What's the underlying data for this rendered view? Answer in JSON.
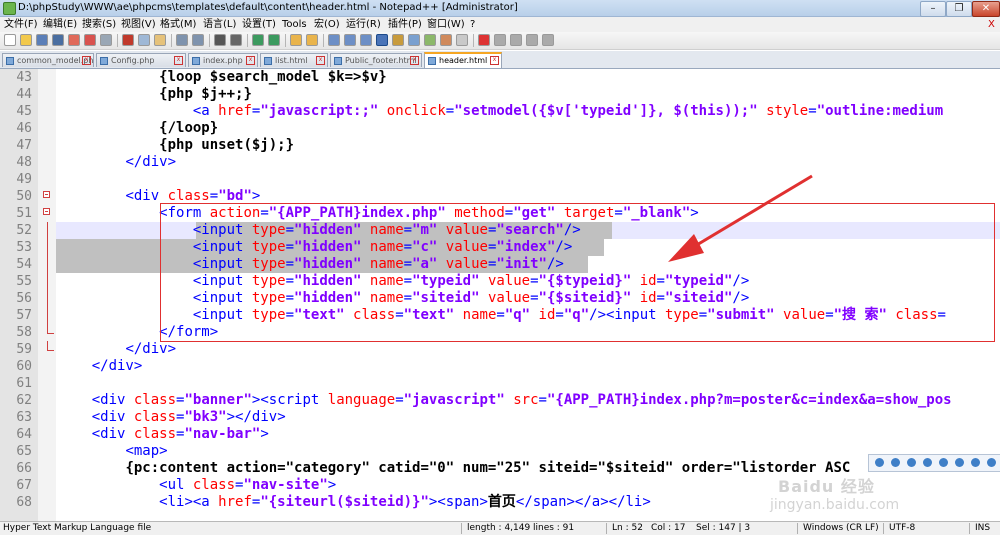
{
  "window": {
    "title": "D:\\phpStudy\\WWW\\ae\\phpcms\\templates\\default\\content\\header.html - Notepad++ [Administrator]",
    "minimize": "–",
    "maximize": "❐",
    "close": "✕"
  },
  "menu": [
    "文件(F)",
    "编辑(E)",
    "搜索(S)",
    "视图(V)",
    "格式(M)",
    "语言(L)",
    "设置(T)",
    "Tools",
    "宏(O)",
    "运行(R)",
    "插件(P)",
    "窗口(W)",
    "?"
  ],
  "menu_close": "X",
  "tabs": [
    {
      "label": "common_model.php",
      "active": false
    },
    {
      "label": "Config.php",
      "active": false
    },
    {
      "label": "index.php",
      "active": false
    },
    {
      "label": "list.html",
      "active": false
    },
    {
      "label": "Public_footer.html",
      "active": false
    },
    {
      "label": "header.html",
      "active": true
    }
  ],
  "editor": {
    "lines": [
      {
        "n": "43",
        "tokens": [
          [
            "t-text",
            "            "
          ],
          [
            "t-php",
            "{loop $search_model $k=>$v}"
          ]
        ]
      },
      {
        "n": "44",
        "tokens": [
          [
            "t-text",
            "            "
          ],
          [
            "t-php",
            "{php $j++;}"
          ]
        ]
      },
      {
        "n": "45",
        "tokens": [
          [
            "t-text",
            "                "
          ],
          [
            "t-tag",
            "<a "
          ],
          [
            "t-attr",
            "href"
          ],
          [
            "t-tag",
            "="
          ],
          [
            "t-val",
            "\"javascript:;\""
          ],
          [
            "t-text",
            " "
          ],
          [
            "t-attr",
            "onclick"
          ],
          [
            "t-tag",
            "="
          ],
          [
            "t-val",
            "\"setmodel({$v['typeid']}, $(this));\""
          ],
          [
            "t-text",
            " "
          ],
          [
            "t-attr",
            "style"
          ],
          [
            "t-tag",
            "="
          ],
          [
            "t-val",
            "\"outline:medium"
          ]
        ]
      },
      {
        "n": "46",
        "tokens": [
          [
            "t-text",
            "            "
          ],
          [
            "t-php",
            "{/loop}"
          ]
        ]
      },
      {
        "n": "47",
        "tokens": [
          [
            "t-text",
            "            "
          ],
          [
            "t-php",
            "{php unset($j);}"
          ]
        ]
      },
      {
        "n": "48",
        "tokens": [
          [
            "t-text",
            "        "
          ],
          [
            "t-tag",
            "</div>"
          ]
        ]
      },
      {
        "n": "49",
        "tokens": []
      },
      {
        "n": "50",
        "tokens": [
          [
            "t-text",
            "        "
          ],
          [
            "t-tag",
            "<div "
          ],
          [
            "t-attr",
            "class"
          ],
          [
            "t-tag",
            "="
          ],
          [
            "t-val",
            "\"bd\""
          ],
          [
            "t-tag",
            ">"
          ]
        ]
      },
      {
        "n": "51",
        "tokens": [
          [
            "t-text",
            "            "
          ],
          [
            "t-tag",
            "<form "
          ],
          [
            "t-attr",
            "action"
          ],
          [
            "t-tag",
            "="
          ],
          [
            "t-val",
            "\"{APP_PATH}index.php\""
          ],
          [
            "t-text",
            " "
          ],
          [
            "t-attr",
            "method"
          ],
          [
            "t-tag",
            "="
          ],
          [
            "t-val",
            "\"get\""
          ],
          [
            "t-text",
            " "
          ],
          [
            "t-attr",
            "target"
          ],
          [
            "t-tag",
            "="
          ],
          [
            "t-val",
            "\"_blank\""
          ],
          [
            "t-tag",
            ">"
          ]
        ]
      },
      {
        "n": "52",
        "tokens": [
          [
            "t-text",
            "                "
          ],
          [
            "t-tag",
            "<input "
          ],
          [
            "t-attr",
            "type"
          ],
          [
            "t-tag",
            "="
          ],
          [
            "t-val",
            "\"hidden\""
          ],
          [
            "t-text",
            " "
          ],
          [
            "t-attr",
            "name"
          ],
          [
            "t-tag",
            "="
          ],
          [
            "t-val",
            "\"m\""
          ],
          [
            "t-text",
            " "
          ],
          [
            "t-attr",
            "value"
          ],
          [
            "t-tag",
            "="
          ],
          [
            "t-val",
            "\"search\""
          ],
          [
            "t-tag",
            "/>"
          ]
        ]
      },
      {
        "n": "53",
        "tokens": [
          [
            "t-text",
            "                "
          ],
          [
            "t-tag",
            "<input "
          ],
          [
            "t-attr",
            "type"
          ],
          [
            "t-tag",
            "="
          ],
          [
            "t-val",
            "\"hidden\""
          ],
          [
            "t-text",
            " "
          ],
          [
            "t-attr",
            "name"
          ],
          [
            "t-tag",
            "="
          ],
          [
            "t-val",
            "\"c\""
          ],
          [
            "t-text",
            " "
          ],
          [
            "t-attr",
            "value"
          ],
          [
            "t-tag",
            "="
          ],
          [
            "t-val",
            "\"index\""
          ],
          [
            "t-tag",
            "/>"
          ]
        ]
      },
      {
        "n": "54",
        "tokens": [
          [
            "t-text",
            "                "
          ],
          [
            "t-tag",
            "<input "
          ],
          [
            "t-attr",
            "type"
          ],
          [
            "t-tag",
            "="
          ],
          [
            "t-val",
            "\"hidden\""
          ],
          [
            "t-text",
            " "
          ],
          [
            "t-attr",
            "name"
          ],
          [
            "t-tag",
            "="
          ],
          [
            "t-val",
            "\"a\""
          ],
          [
            "t-text",
            " "
          ],
          [
            "t-attr",
            "value"
          ],
          [
            "t-tag",
            "="
          ],
          [
            "t-val",
            "\"init\""
          ],
          [
            "t-tag",
            "/>"
          ]
        ]
      },
      {
        "n": "55",
        "tokens": [
          [
            "t-text",
            "                "
          ],
          [
            "t-tag",
            "<input "
          ],
          [
            "t-attr",
            "type"
          ],
          [
            "t-tag",
            "="
          ],
          [
            "t-val",
            "\"hidden\""
          ],
          [
            "t-text",
            " "
          ],
          [
            "t-attr",
            "name"
          ],
          [
            "t-tag",
            "="
          ],
          [
            "t-val",
            "\"typeid\""
          ],
          [
            "t-text",
            " "
          ],
          [
            "t-attr",
            "value"
          ],
          [
            "t-tag",
            "="
          ],
          [
            "t-val",
            "\"{$typeid}\""
          ],
          [
            "t-text",
            " "
          ],
          [
            "t-attr",
            "id"
          ],
          [
            "t-tag",
            "="
          ],
          [
            "t-val",
            "\"typeid\""
          ],
          [
            "t-tag",
            "/>"
          ]
        ]
      },
      {
        "n": "56",
        "tokens": [
          [
            "t-text",
            "                "
          ],
          [
            "t-tag",
            "<input "
          ],
          [
            "t-attr",
            "type"
          ],
          [
            "t-tag",
            "="
          ],
          [
            "t-val",
            "\"hidden\""
          ],
          [
            "t-text",
            " "
          ],
          [
            "t-attr",
            "name"
          ],
          [
            "t-tag",
            "="
          ],
          [
            "t-val",
            "\"siteid\""
          ],
          [
            "t-text",
            " "
          ],
          [
            "t-attr",
            "value"
          ],
          [
            "t-tag",
            "="
          ],
          [
            "t-val",
            "\"{$siteid}\""
          ],
          [
            "t-text",
            " "
          ],
          [
            "t-attr",
            "id"
          ],
          [
            "t-tag",
            "="
          ],
          [
            "t-val",
            "\"siteid\""
          ],
          [
            "t-tag",
            "/>"
          ]
        ]
      },
      {
        "n": "57",
        "tokens": [
          [
            "t-text",
            "                "
          ],
          [
            "t-tag",
            "<input "
          ],
          [
            "t-attr",
            "type"
          ],
          [
            "t-tag",
            "="
          ],
          [
            "t-val",
            "\"text\""
          ],
          [
            "t-text",
            " "
          ],
          [
            "t-attr",
            "class"
          ],
          [
            "t-tag",
            "="
          ],
          [
            "t-val",
            "\"text\""
          ],
          [
            "t-text",
            " "
          ],
          [
            "t-attr",
            "name"
          ],
          [
            "t-tag",
            "="
          ],
          [
            "t-val",
            "\"q\""
          ],
          [
            "t-text",
            " "
          ],
          [
            "t-attr",
            "id"
          ],
          [
            "t-tag",
            "="
          ],
          [
            "t-val",
            "\"q\""
          ],
          [
            "t-tag",
            "/><input "
          ],
          [
            "t-attr",
            "type"
          ],
          [
            "t-tag",
            "="
          ],
          [
            "t-val",
            "\"submit\""
          ],
          [
            "t-text",
            " "
          ],
          [
            "t-attr",
            "value"
          ],
          [
            "t-tag",
            "="
          ],
          [
            "t-val",
            "\"搜 索\""
          ],
          [
            "t-text",
            " "
          ],
          [
            "t-attr",
            "class"
          ],
          [
            "t-tag",
            "="
          ]
        ]
      },
      {
        "n": "58",
        "tokens": [
          [
            "t-text",
            "            "
          ],
          [
            "t-tag",
            "</form>"
          ]
        ]
      },
      {
        "n": "59",
        "tokens": [
          [
            "t-text",
            "        "
          ],
          [
            "t-tag",
            "</div>"
          ]
        ]
      },
      {
        "n": "60",
        "tokens": [
          [
            "t-text",
            "    "
          ],
          [
            "t-tag",
            "</div>"
          ]
        ]
      },
      {
        "n": "61",
        "tokens": []
      },
      {
        "n": "62",
        "tokens": [
          [
            "t-text",
            "    "
          ],
          [
            "t-tag",
            "<div "
          ],
          [
            "t-attr",
            "class"
          ],
          [
            "t-tag",
            "="
          ],
          [
            "t-val",
            "\"banner\""
          ],
          [
            "t-tag",
            "><script "
          ],
          [
            "t-attr",
            "language"
          ],
          [
            "t-tag",
            "="
          ],
          [
            "t-val",
            "\"javascript\""
          ],
          [
            "t-text",
            " "
          ],
          [
            "t-attr",
            "src"
          ],
          [
            "t-tag",
            "="
          ],
          [
            "t-val",
            "\"{APP_PATH}index.php?m=poster&c=index&a=show_pos"
          ]
        ]
      },
      {
        "n": "63",
        "tokens": [
          [
            "t-text",
            "    "
          ],
          [
            "t-tag",
            "<div "
          ],
          [
            "t-attr",
            "class"
          ],
          [
            "t-tag",
            "="
          ],
          [
            "t-val",
            "\"bk3\""
          ],
          [
            "t-tag",
            "></div>"
          ]
        ]
      },
      {
        "n": "64",
        "tokens": [
          [
            "t-text",
            "    "
          ],
          [
            "t-tag",
            "<div "
          ],
          [
            "t-attr",
            "class"
          ],
          [
            "t-tag",
            "="
          ],
          [
            "t-val",
            "\"nav-bar\""
          ],
          [
            "t-tag",
            ">"
          ]
        ]
      },
      {
        "n": "65",
        "tokens": [
          [
            "t-text",
            "        "
          ],
          [
            "t-tag",
            "<map>"
          ]
        ]
      },
      {
        "n": "66",
        "tokens": [
          [
            "t-text",
            "        "
          ],
          [
            "t-php",
            "{pc:content action=\"category\" catid=\"0\" num=\"25\" siteid=\"$siteid\" order=\"listorder ASC"
          ]
        ]
      },
      {
        "n": "67",
        "tokens": [
          [
            "t-text",
            "            "
          ],
          [
            "t-tag",
            "<ul "
          ],
          [
            "t-attr",
            "class"
          ],
          [
            "t-tag",
            "="
          ],
          [
            "t-val",
            "\"nav-site\""
          ],
          [
            "t-tag",
            ">"
          ]
        ]
      },
      {
        "n": "68",
        "tokens": [
          [
            "t-text",
            "            "
          ],
          [
            "t-tag",
            "<li><a "
          ],
          [
            "t-attr",
            "href"
          ],
          [
            "t-tag",
            "="
          ],
          [
            "t-val",
            "\"{siteurl($siteid)}\""
          ],
          [
            "t-tag",
            "><span>"
          ],
          [
            "t-text",
            "首页"
          ],
          [
            "t-tag",
            "</span></a></li>"
          ]
        ]
      }
    ]
  },
  "watermark": {
    "line1": "Baidu 经验",
    "line2": "jingyan.baidu.com"
  },
  "status": {
    "filetype": "Hyper Text Markup Language file",
    "length": "length : 4,149",
    "lines": "lines : 91",
    "ln": "Ln : 52",
    "col": "Col : 17",
    "sel": "Sel : 147 | 3",
    "eol": "Windows (CR LF)",
    "enc": "UTF-8",
    "ins": "INS"
  },
  "colors": {
    "tag": "#0000ff",
    "attr": "#ff0000",
    "value": "#8000ff",
    "selection": "#c0c0c0",
    "annotation": "#e03030"
  }
}
